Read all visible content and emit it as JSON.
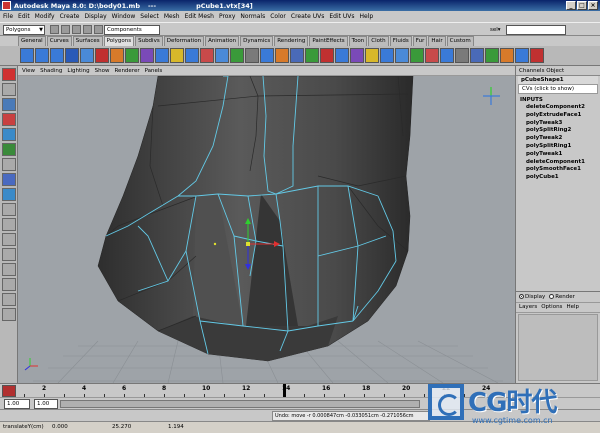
{
  "window": {
    "title": "Autodesk Maya 8.0: D:\\body01.mb  ---  pCube1.vtx[34]",
    "title_app": "Autodesk Maya 8.0: D:\\body01.mb",
    "title_sep": "---",
    "title_selection": "pCube1.vtx[34]"
  },
  "menubar": [
    "File",
    "Edit",
    "Modify",
    "Create",
    "Display",
    "Window",
    "Select",
    "Mesh",
    "Edit Mesh",
    "Proxy",
    "Normals",
    "Color",
    "Create UVs",
    "Edit UVs",
    "Help"
  ],
  "statusline": {
    "mode": "Polygons",
    "component_field": "Components",
    "sel_label": "sel▾"
  },
  "shelf_tabs": [
    "General",
    "Curves",
    "Surfaces",
    "Polygons",
    "Subdivs",
    "Deformation",
    "Animation",
    "Dynamics",
    "Rendering",
    "PaintEffects",
    "Toon",
    "Cloth",
    "Fluids",
    "Fur",
    "Hair",
    "Custom"
  ],
  "shelf_active_tab": "Polygons",
  "viewport_menu": [
    "View",
    "Shading",
    "Lighting",
    "Show",
    "Renderer",
    "Panels"
  ],
  "channel_box": {
    "tabs": "Channels Object",
    "shape_label": "pCubeShape1",
    "vrts_label": "CVs (click to show)",
    "inputs_label": "INPUTS",
    "inputs": [
      "deleteComponent2",
      "polyExtrudeFace1",
      "polyTweak3",
      "polySplitRing2",
      "polyTweak2",
      "polySplitRing1",
      "polyTweak1",
      "deleteComponent1",
      "polySmoothFace1",
      "polyCube1"
    ]
  },
  "layer_editor": {
    "display_label": "Display",
    "render_label": "Render",
    "menu": [
      "Layers",
      "Options",
      "Help"
    ]
  },
  "timeslider": {
    "ticks": [
      "2",
      "4",
      "6",
      "8",
      "10",
      "12",
      "14",
      "16",
      "18",
      "20",
      "22",
      "24"
    ],
    "current_frame": 14
  },
  "rangeslider": {
    "start": "1.00",
    "end": "1.00"
  },
  "helpline": {
    "text": "Undo: move -r 0.000847cm -0.033051cm -0.271056cm"
  },
  "infobar": {
    "label": "translateY(cm)",
    "value1": "0.000",
    "value2": "25.270",
    "value3": "1.194"
  },
  "watermark": {
    "brand": "CG时代",
    "url": "www.cgtime.com.cn"
  },
  "colors": {
    "wire": "#63c9e6",
    "mesh_dark": "#3e3e3e",
    "viewport_bg": "#9ea3a8",
    "title_bar": "#0a246a",
    "brand": "#2f6fb8"
  }
}
